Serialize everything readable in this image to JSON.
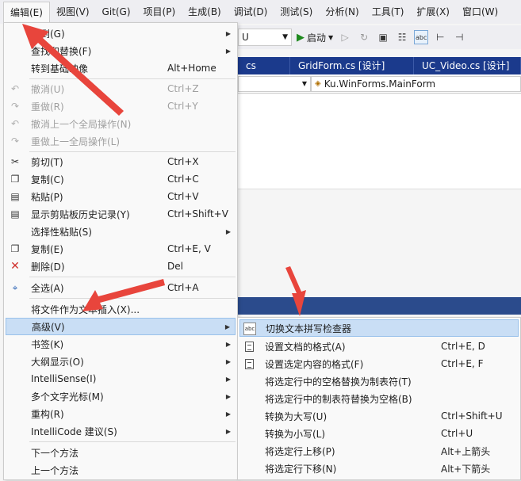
{
  "menubar": {
    "items": [
      "编辑(E)",
      "视图(V)",
      "Git(G)",
      "项目(P)",
      "生成(B)",
      "调试(D)",
      "测试(S)",
      "分析(N)",
      "工具(T)",
      "扩展(X)",
      "窗口(W)"
    ]
  },
  "toolbar": {
    "config_value": "U",
    "start_label": "启动",
    "abc_label": "abc"
  },
  "tabs": [
    "cs",
    "GridForm.cs [设计]",
    "UC_Video.cs [设计]"
  ],
  "navbar": {
    "class_value": "Ku.WinForms.MainForm"
  },
  "edit_menu": {
    "items": [
      {
        "label": "转到(G)",
        "shortcut": "",
        "submenu": true,
        "disabled": false,
        "icon": ""
      },
      {
        "label": "查找和替换(F)",
        "shortcut": "",
        "submenu": true,
        "disabled": false,
        "icon": ""
      },
      {
        "label": "转到基础映像",
        "shortcut": "Alt+Home",
        "submenu": false,
        "disabled": false,
        "icon": ""
      },
      {
        "label": "撤消(U)",
        "shortcut": "Ctrl+Z",
        "submenu": false,
        "disabled": true,
        "icon": "undo-icon"
      },
      {
        "label": "重做(R)",
        "shortcut": "Ctrl+Y",
        "submenu": false,
        "disabled": true,
        "icon": "redo-icon"
      },
      {
        "label": "撤消上一个全局操作(N)",
        "shortcut": "",
        "submenu": false,
        "disabled": true,
        "icon": "undo-global-icon"
      },
      {
        "label": "重做上一全局操作(L)",
        "shortcut": "",
        "submenu": false,
        "disabled": true,
        "icon": "redo-global-icon"
      },
      {
        "label": "剪切(T)",
        "shortcut": "Ctrl+X",
        "submenu": false,
        "disabled": false,
        "icon": "scissors-icon"
      },
      {
        "label": "复制(C)",
        "shortcut": "Ctrl+C",
        "submenu": false,
        "disabled": false,
        "icon": "copy-icon"
      },
      {
        "label": "粘贴(P)",
        "shortcut": "Ctrl+V",
        "submenu": false,
        "disabled": false,
        "icon": "paste-icon"
      },
      {
        "label": "显示剪贴板历史记录(Y)",
        "shortcut": "Ctrl+Shift+V",
        "submenu": false,
        "disabled": false,
        "icon": "clipboard-history-icon"
      },
      {
        "label": "选择性粘贴(S)",
        "shortcut": "",
        "submenu": true,
        "disabled": false,
        "icon": ""
      },
      {
        "label": "复制(E)",
        "shortcut": "Ctrl+E, V",
        "submenu": false,
        "disabled": false,
        "icon": "duplicate-icon"
      },
      {
        "label": "删除(D)",
        "shortcut": "Del",
        "submenu": false,
        "disabled": false,
        "icon": "delete-icon"
      },
      {
        "label": "全选(A)",
        "shortcut": "Ctrl+A",
        "submenu": false,
        "disabled": false,
        "icon": "select-all-icon"
      },
      {
        "label": "将文件作为文本插入(X)...",
        "shortcut": "",
        "submenu": false,
        "disabled": false,
        "icon": ""
      },
      {
        "label": "高级(V)",
        "shortcut": "",
        "submenu": true,
        "disabled": false,
        "icon": ""
      },
      {
        "label": "书签(K)",
        "shortcut": "",
        "submenu": true,
        "disabled": false,
        "icon": ""
      },
      {
        "label": "大纲显示(O)",
        "shortcut": "",
        "submenu": true,
        "disabled": false,
        "icon": ""
      },
      {
        "label": "IntelliSense(I)",
        "shortcut": "",
        "submenu": true,
        "disabled": false,
        "icon": ""
      },
      {
        "label": "多个文字光标(M)",
        "shortcut": "",
        "submenu": true,
        "disabled": false,
        "icon": ""
      },
      {
        "label": "重构(R)",
        "shortcut": "",
        "submenu": true,
        "disabled": false,
        "icon": ""
      },
      {
        "label": "IntelliCode 建议(S)",
        "shortcut": "",
        "submenu": true,
        "disabled": false,
        "icon": ""
      },
      {
        "label": "下一个方法",
        "shortcut": "",
        "submenu": false,
        "disabled": false,
        "icon": ""
      },
      {
        "label": "上一个方法",
        "shortcut": "",
        "submenu": false,
        "disabled": false,
        "icon": ""
      }
    ]
  },
  "advanced_menu": {
    "items": [
      {
        "label": "切换文本拼写检查器",
        "shortcut": "",
        "icon": "spellcheck-icon"
      },
      {
        "label": "设置文档的格式(A)",
        "shortcut": "Ctrl+E, D",
        "icon": "format-document-icon"
      },
      {
        "label": "设置选定内容的格式(F)",
        "shortcut": "Ctrl+E, F",
        "icon": "format-selection-icon"
      },
      {
        "label": "将选定行中的空格替换为制表符(T)",
        "shortcut": "",
        "icon": ""
      },
      {
        "label": "将选定行中的制表符替换为空格(B)",
        "shortcut": "",
        "icon": ""
      },
      {
        "label": "转换为大写(U)",
        "shortcut": "Ctrl+Shift+U",
        "icon": ""
      },
      {
        "label": "转换为小写(L)",
        "shortcut": "Ctrl+U",
        "icon": ""
      },
      {
        "label": "将选定行上移(P)",
        "shortcut": "Alt+上箭头",
        "icon": ""
      },
      {
        "label": "将选定行下移(N)",
        "shortcut": "Alt+下箭头",
        "icon": ""
      }
    ]
  },
  "colors": {
    "highlight": "#c9def5",
    "tabstrip": "#1b3a8c",
    "annotation_arrow": "#e8453c"
  }
}
